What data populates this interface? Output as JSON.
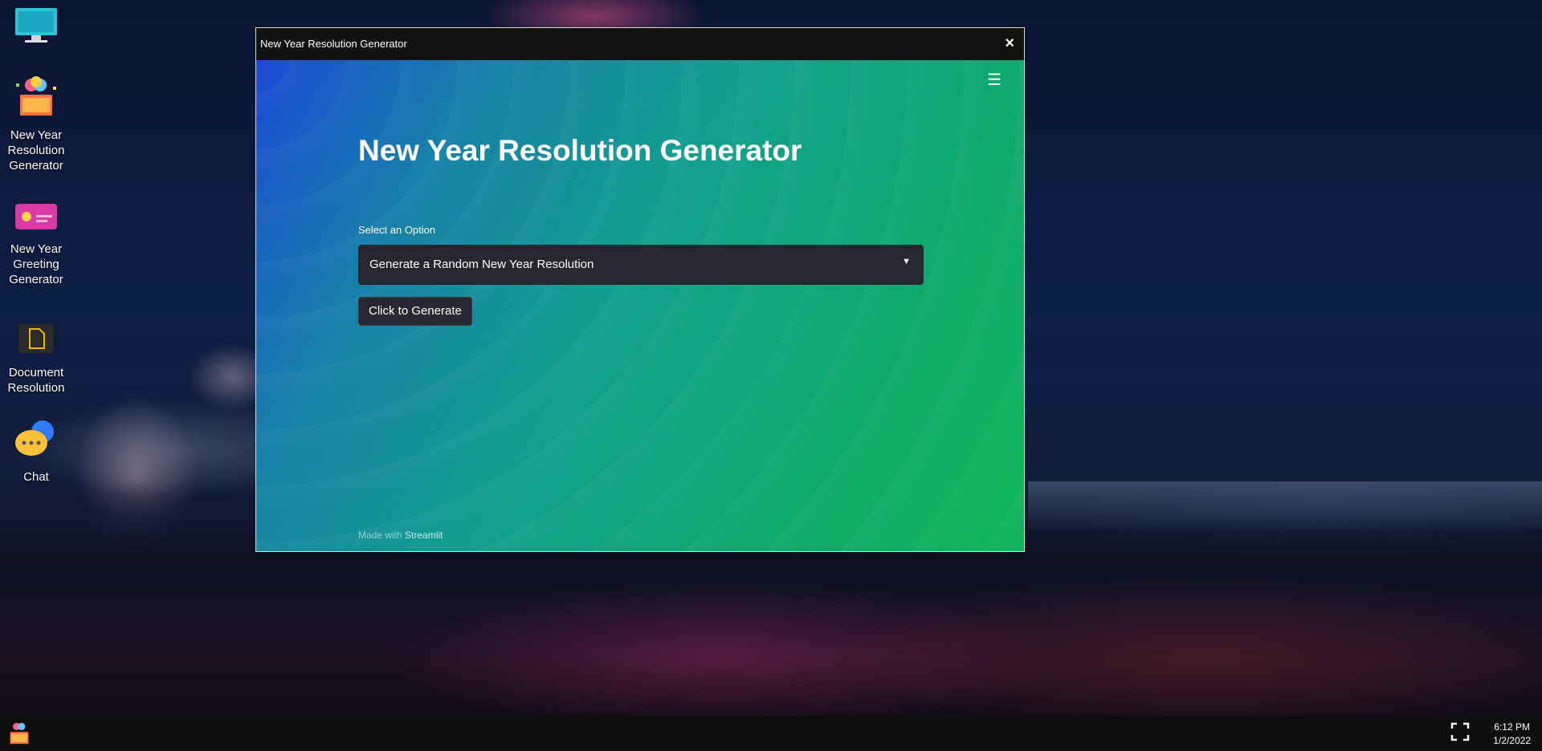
{
  "desktop": {
    "icons": [
      {
        "name": "monitor",
        "label": ""
      },
      {
        "name": "new-year-resolution-generator",
        "label": "New Year Resolution Generator"
      },
      {
        "name": "new-year-greeting-generator",
        "label": "New Year Greeting Generator"
      },
      {
        "name": "document-resolution",
        "label": "Document Resolution"
      },
      {
        "name": "chat",
        "label": "Chat"
      }
    ]
  },
  "window": {
    "title": "New Year Resolution Generator",
    "close_icon": "×"
  },
  "app": {
    "menu_icon": "☰",
    "heading": "New Year Resolution Generator",
    "select_label": "Select an Option",
    "select_value": "Generate a Random New Year Resolution",
    "button_label": "Click to Generate",
    "footer_prefix": "Made with",
    "footer_brand": "Streamlit"
  },
  "taskbar": {
    "time": "6:12 PM",
    "date": "1/2/2022"
  },
  "colors": {
    "accent_gradient_start": "#1b49d6",
    "accent_gradient_end": "#10b55a",
    "control_bg": "#262730"
  }
}
